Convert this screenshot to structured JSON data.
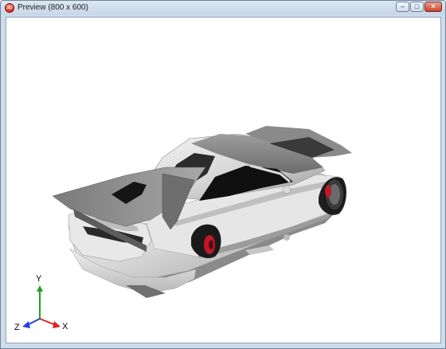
{
  "window": {
    "title": "Preview (800 x 600)",
    "app_icon_text": "3D"
  },
  "controls": {
    "minimize_glyph": "–",
    "maximize_glyph": "□",
    "close_glyph": "✕"
  },
  "gizmo": {
    "x_label": "X",
    "y_label": "Y",
    "z_label": "Z",
    "x_color": "#e02020",
    "y_color": "#20a020",
    "z_color": "#2040e0"
  }
}
